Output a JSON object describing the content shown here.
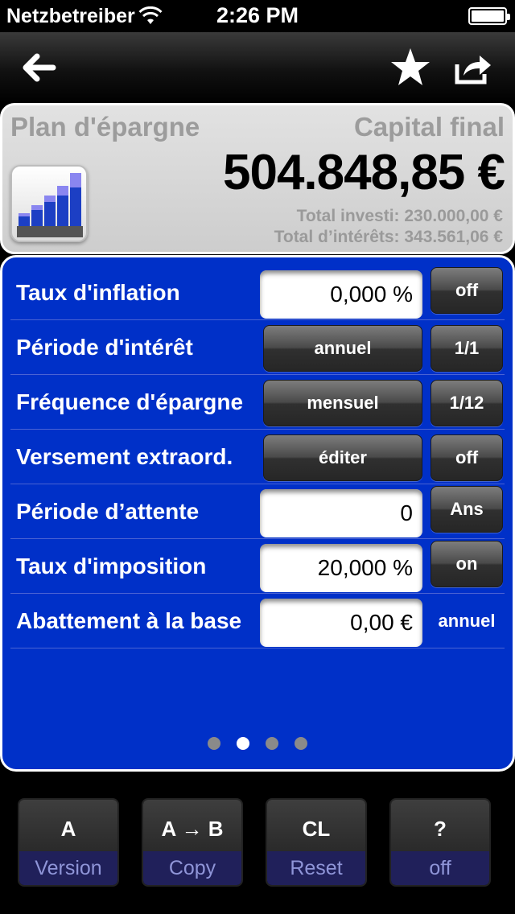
{
  "status_bar": {
    "carrier": "Netzbetreiber",
    "time": "2:26 PM",
    "icons": [
      "wifi-icon",
      "battery-icon"
    ]
  },
  "nav": {
    "icons": [
      "back-arrow-icon",
      "star-icon",
      "share-icon"
    ]
  },
  "summary": {
    "plan_title": "Plan d'épargne",
    "capital_label": "Capital final",
    "capital_value": "504.848,85 €",
    "total_invested": "Total investi: 230.000,00 €",
    "total_interest": "Total d’intérêts: 343.561,06 €",
    "icon": "savings-chart-icon"
  },
  "settings": {
    "rows": [
      {
        "label": "Taux d'inflation",
        "value": "0,000 %",
        "toggle": "off"
      },
      {
        "label": "Période d'intérêt",
        "option": "annuel",
        "ratio": "1/1"
      },
      {
        "label": "Fréquence d'épargne",
        "option": "mensuel",
        "ratio": "1/12"
      },
      {
        "label": "Versement extraord.",
        "option": "éditer",
        "toggle": "off"
      },
      {
        "label": "Période d’attente",
        "value": "0",
        "unit": "Ans"
      },
      {
        "label": "Taux d'imposition",
        "value": "20,000 %",
        "toggle": "on"
      },
      {
        "label": "Abattement à la base",
        "value": "0,00 €",
        "unit": "annuel"
      }
    ],
    "page_indicator": {
      "total": 4,
      "current": 2
    }
  },
  "keys": [
    {
      "top": "A",
      "bottom": "Version"
    },
    {
      "top": "A → B",
      "bottom": "Copy"
    },
    {
      "top": "CL",
      "bottom": "Reset"
    },
    {
      "top": "?",
      "bottom": "off"
    }
  ],
  "colors": {
    "panel_blue": "#0030c8",
    "summary_gray": "#d6d6d6",
    "key_label_blue": "#8f95d8"
  }
}
